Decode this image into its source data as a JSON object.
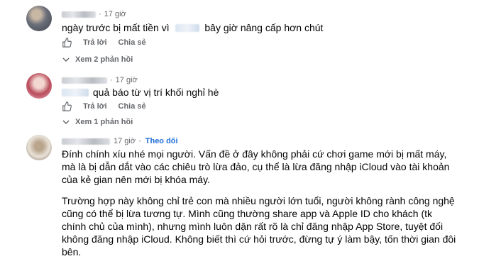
{
  "comments": [
    {
      "time": "17 giờ",
      "text_before": "ngày trước bị mất tiền vì",
      "text_after": "bây giờ nâng cấp hơn chút",
      "like_icon": "thumbs-up-icon",
      "reply_label": "Trả lời",
      "share_label": "Chia sẻ",
      "view_replies": "Xem 2 phản hồi",
      "avatar_colors": [
        "#6b6f7a",
        "#c8b7a3",
        "#3f434b"
      ]
    },
    {
      "time": "17 giờ",
      "text": "quả báo từ vị trí khối nghỉ hè",
      "like_icon": "thumbs-up-icon",
      "reply_label": "Trả lời",
      "share_label": "Chia sẻ",
      "view_replies": "Xem 1 phản hồi",
      "avatar_colors": [
        "#e8b5c1",
        "#b94c5a",
        "#f2d6cf"
      ]
    },
    {
      "time": "17 giờ",
      "follow_label": "Theo dõi",
      "paragraphs": [
        "Đính chính xíu nhé mọi người. Vấn đề ở đây không phải cứ chơi game mới bị mất máy, mà là bị dẫn dắt vào các chiêu trò lừa đảo, cụ thể là lừa đăng nhập iCloud vào tài khoản của kẻ gian nên mới bị khóa máy.",
        "Trường hợp này không chỉ trẻ con mà nhiều người lớn tuổi, người không rành công nghệ cũng có thể bị lừa tương tự. Mình cũng thường share app và Apple ID cho khách (tk chính chủ của mình), nhưng mình luôn dặn rất rõ là chỉ đăng nhập App Store, tuyệt đối không đăng nhập iCloud. Không biết thì cứ hỏi trước, đừng tự ý làm bậy, tốn thời gian đôi bên."
      ],
      "avatar_colors": [
        "#e9e2d8",
        "#b9a48c",
        "#7a6a58"
      ]
    }
  ],
  "colors": {
    "meta": "#65676b",
    "link": "#216fdb",
    "text": "#050505"
  }
}
